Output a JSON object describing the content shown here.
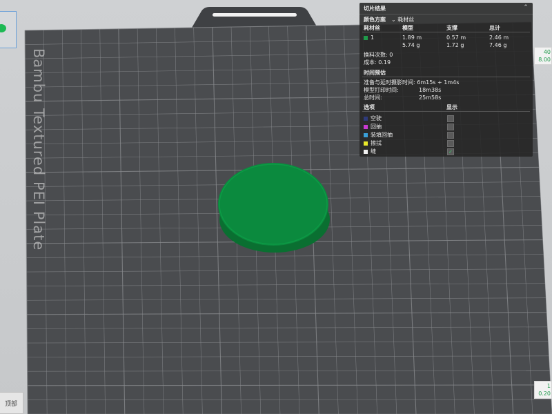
{
  "plate": {
    "label": "Bambu Textured PEI Plate",
    "bed_color": "#4a4c4f",
    "grid_color": "#8b8d90",
    "model_color": "#0b8a3e"
  },
  "layer_slider": {
    "top_layer": "40",
    "top_height": "8.00",
    "bottom_layer": "1",
    "bottom_height": "0.20"
  },
  "view_button": "顶部",
  "panel": {
    "title": "切片结果",
    "color_scheme_label": "颜色方案",
    "color_scheme_value": "耗材丝",
    "headers": {
      "filament": "耗材丝",
      "model": "模型",
      "support": "支撑",
      "total": "总计"
    },
    "filament_row": {
      "id": "1",
      "color": "#1f9a4a",
      "model_length": "1.89 m",
      "model_weight": "5.74 g",
      "support_length": "0.57 m",
      "support_weight": "1.72 g",
      "total_length": "2.46 m",
      "total_weight": "7.46 g"
    },
    "changes_label": "换料次数: 0",
    "cost_label": "成本: 0.19",
    "time_section": "时间预估",
    "prep_time": "准备与延时摄影时间: 6m15s + 1m4s",
    "print_time_label": "模型打印时间:",
    "print_time_value": "18m38s",
    "total_time_label": "总时间:",
    "total_time_value": "25m58s",
    "options_header": "选项",
    "display_header": "显示",
    "options": [
      {
        "label": "空驶",
        "color": "#2e3a7a",
        "checked": false
      },
      {
        "label": "回抽",
        "color": "#c83ad0",
        "checked": false
      },
      {
        "label": "装填回抽",
        "color": "#3aa0d8",
        "checked": false
      },
      {
        "label": "擦拭",
        "color": "#e8e82a",
        "checked": false
      },
      {
        "label": "缝",
        "color": "#f0f0f0",
        "checked": true
      }
    ]
  }
}
